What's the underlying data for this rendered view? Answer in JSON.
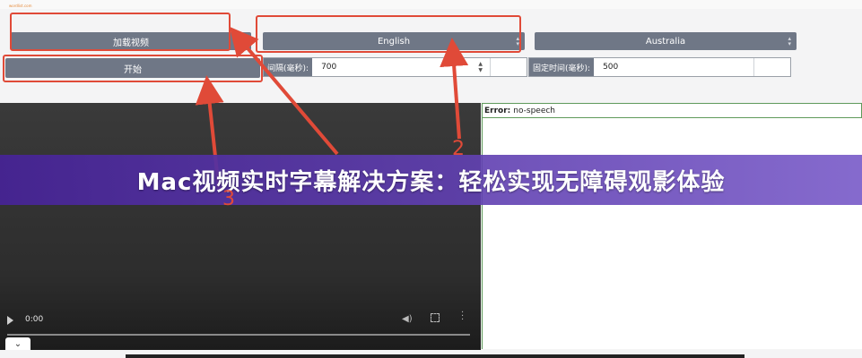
{
  "header": {
    "logo_text": "wordlist.com"
  },
  "toolbar": {
    "load_video_label": "加载视频",
    "start_label": "开始",
    "language_select": {
      "selected": "English"
    },
    "region_select": {
      "selected": "Australia"
    },
    "interval_field": {
      "label": "间隔(毫秒):",
      "value": "700"
    },
    "fixed_time_field": {
      "label": "固定时间(毫秒):",
      "value": "500"
    }
  },
  "video": {
    "time": "0:00"
  },
  "error_panel": {
    "label": "Error:",
    "message": "no-speech"
  },
  "annotations": {
    "n2": "2",
    "n3": "3"
  },
  "banner": {
    "title": "Mac视频实时字幕解决方案：轻松实现无障碍观影体验"
  },
  "bottom": {
    "tab_glyph": "⌄"
  },
  "colors": {
    "accent": "#e04a38",
    "button": "#6f7786",
    "banner_start": "#46239a",
    "banner_end": "#785ac8"
  }
}
